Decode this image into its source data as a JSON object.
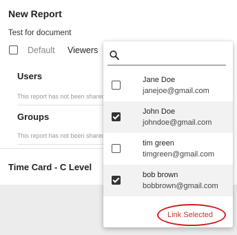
{
  "report": {
    "title": "New Report",
    "description": "Test for document",
    "default_label": "Default",
    "default_checked": false,
    "viewers_label": "Viewers",
    "users_heading": "Users",
    "users_note": "This report has not been shared",
    "groups_heading": "Groups",
    "groups_note": "This report has not been shared"
  },
  "next_report": {
    "title": "Time Card - C Level"
  },
  "dropdown": {
    "search_placeholder": "",
    "search_value": "",
    "users": [
      {
        "name": "Jane Doe",
        "email": "janejoe@gmail.com",
        "checked": false
      },
      {
        "name": "John Doe",
        "email": "johndoe@gmail.com",
        "checked": true
      },
      {
        "name": "tim green",
        "email": "timgreen@gmail.com",
        "checked": false
      },
      {
        "name": "bob brown",
        "email": "bobbrown@gmail.com",
        "checked": true
      }
    ],
    "link_label": "Link Selected"
  },
  "colors": {
    "link": "#c0392b",
    "annotation_circle": "#d9191a",
    "background_gray": "#ececec"
  },
  "icons": {
    "search": "search-icon"
  }
}
